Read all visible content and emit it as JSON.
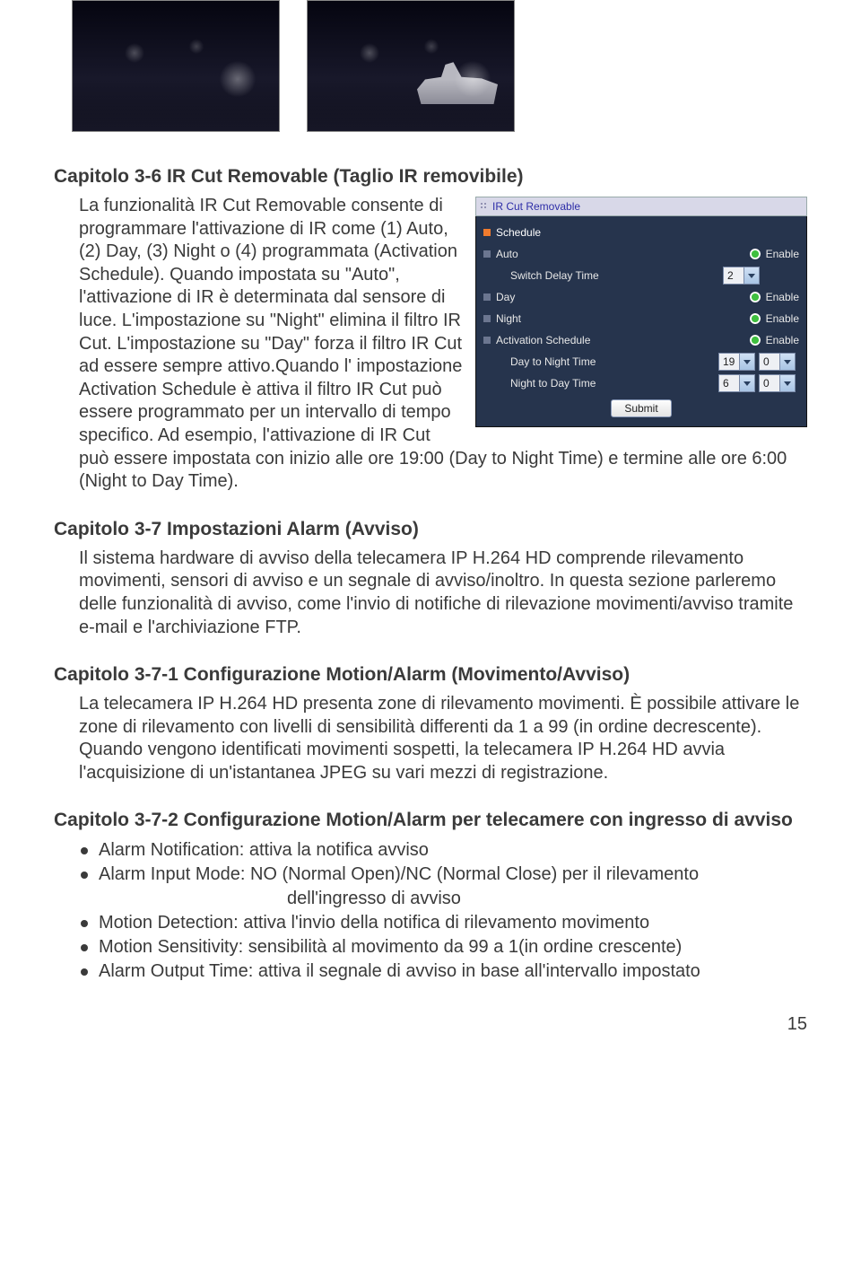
{
  "panel": {
    "title": "IR Cut Removable",
    "schedule": "Schedule",
    "rows": {
      "auto": {
        "label": "Auto",
        "enable": "Enable"
      },
      "switch_delay": {
        "label": "Switch Delay Time",
        "value": "2"
      },
      "day": {
        "label": "Day",
        "enable": "Enable"
      },
      "night": {
        "label": "Night",
        "enable": "Enable"
      },
      "activation": {
        "label": "Activation Schedule",
        "enable": "Enable"
      },
      "day_to_night": {
        "label": "Day to Night Time",
        "h": "19",
        "m": "0"
      },
      "night_to_day": {
        "label": "Night to Day Time",
        "h": "6",
        "m": "0"
      }
    },
    "submit": "Submit"
  },
  "s36": {
    "heading": "Capitolo 3-6 IR Cut Removable (Taglio IR removibile)",
    "p1a": "La funzionalità IR Cut Removable consente di programmare l'attivazione di IR come (1) Auto, (2) Day, (3) Night o (4) programmata (Activation Schedule). Quando impostata su \"Auto\", l'attivazione di IR è determinata dal sensore di luce. L'impostazione su \"Night\" elimina il filtro IR Cut. L'impostazione su \"Day\" forza il filtro IR Cut ad essere sempre attivo.Quando l'",
    "p1b": "impostazione Activation Schedule è attiva il filtro IR Cut può essere programmato per un intervallo di tempo specifico. Ad esempio, l'attivazione di IR Cut può essere impostata con inizio alle ore 19:00 (Day to Night Time) e termine alle ore 6:00 (Night to Day Time)."
  },
  "s37": {
    "heading": "Capitolo 3-7 Impostazioni Alarm (Avviso)",
    "p": "Il sistema hardware di avviso della telecamera IP H.264 HD comprende rilevamento movimenti, sensori di avviso e un segnale di avviso/inoltro. In questa sezione parleremo delle funzionalità di avviso, come l'invio di notifiche di rilevazione movimenti/avviso tramite e-mail e l'archiviazione FTP."
  },
  "s371": {
    "heading": "Capitolo 3-7-1 Configurazione Motion/Alarm (Movimento/Avviso)",
    "p": "La telecamera IP H.264 HD presenta zone di rilevamento movimenti. È possibile attivare le zone di rilevamento con livelli di sensibilità differenti da 1 a 99 (in ordine decrescente). Quando vengono identificati movimenti sospetti, la telecamera IP H.264 HD avvia l'acquisizione di un'istantanea JPEG su vari mezzi di registrazione."
  },
  "s372": {
    "heading": "Capitolo 3-7-2 Configurazione Motion/Alarm per telecamere con ingresso di avviso",
    "b1": "Alarm Notification: attiva la notifica avviso",
    "b2a": "Alarm Input Mode: NO (Normal Open)/NC (Normal Close) per il rilevamento",
    "b2b": "dell'ingresso di avviso",
    "b3": "Motion Detection: attiva l'invio della notifica di rilevamento movimento",
    "b4": "Motion Sensitivity: sensibilità al movimento da 99 a 1(in ordine crescente)",
    "b5": "Alarm Output Time: attiva il segnale di avviso in base all'intervallo impostato"
  },
  "page_number": "15"
}
